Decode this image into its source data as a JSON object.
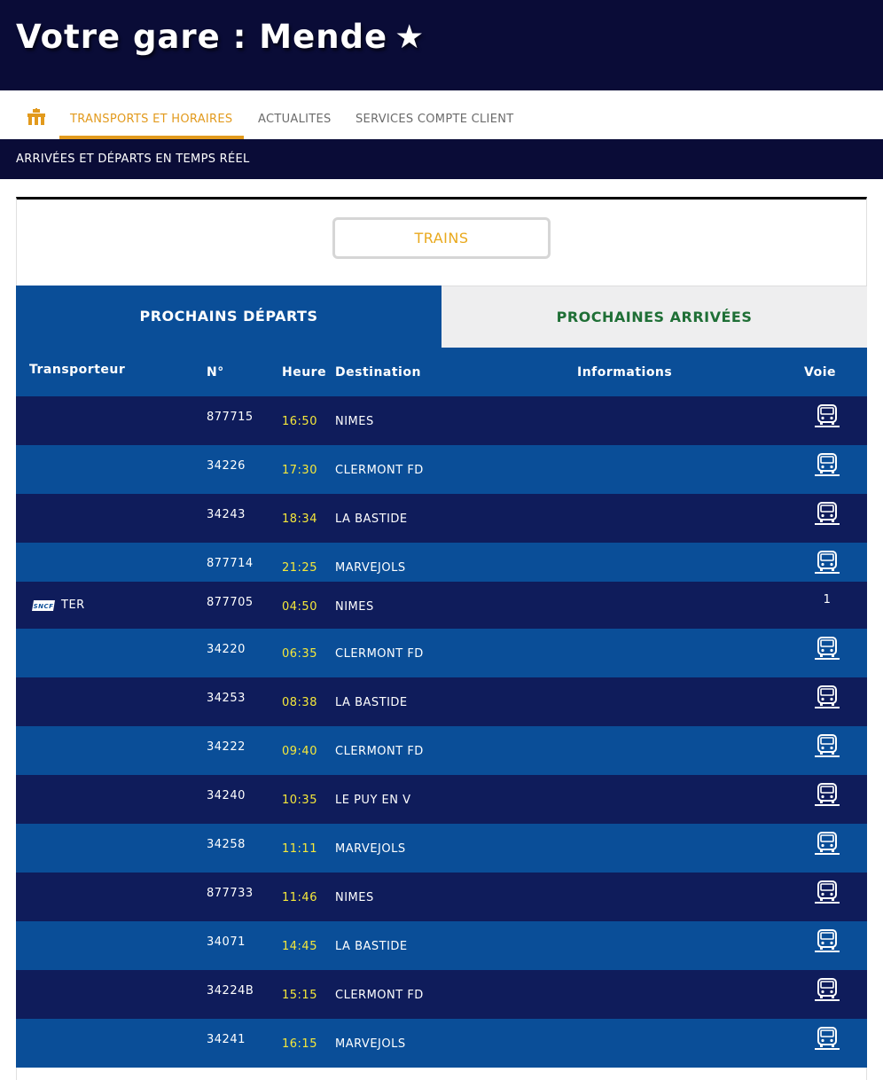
{
  "header": {
    "title": "Votre gare : Mende",
    "star": "★"
  },
  "nav": {
    "items": [
      {
        "label": "TRANSPORTS ET HORAIRES"
      },
      {
        "label": "ACTUALITES"
      },
      {
        "label": "SERVICES COMPTE CLIENT"
      }
    ]
  },
  "subbar": {
    "text": "ARRIVÉES ET DÉPARTS EN TEMPS RÉEL"
  },
  "filter": {
    "trains_label": "TRAINS"
  },
  "tabs": {
    "departures": "PROCHAINS DÉPARTS",
    "arrivals": "PROCHAINES ARRIVÉES"
  },
  "table": {
    "headers": {
      "transporteur": "Transporteur",
      "numero": "N°",
      "heure": "Heure",
      "destination": "Destination",
      "informations": "Informations",
      "voie": "Voie"
    },
    "rows": [
      {
        "carrier": "",
        "number": "877715",
        "time": "16:50",
        "destination": "NIMES",
        "voie": "bus-icon"
      },
      {
        "carrier": "",
        "number": "34226",
        "time": "17:30",
        "destination": "CLERMONT FD",
        "voie": "bus-icon"
      },
      {
        "carrier": "",
        "number": "34243",
        "time": "18:34",
        "destination": "LA BASTIDE",
        "voie": "bus-icon"
      },
      {
        "carrier": "",
        "number": "877714",
        "time": "21:25",
        "destination": "MARVEJOLS",
        "voie": "bus-icon"
      },
      {
        "carrier": "TER",
        "number": "877705",
        "time": "04:50",
        "destination": "NIMES",
        "voie": "1"
      },
      {
        "carrier": "",
        "number": "34220",
        "time": "06:35",
        "destination": "CLERMONT FD",
        "voie": "bus-icon"
      },
      {
        "carrier": "",
        "number": "34253",
        "time": "08:38",
        "destination": "LA BASTIDE",
        "voie": "bus-icon"
      },
      {
        "carrier": "",
        "number": "34222",
        "time": "09:40",
        "destination": "CLERMONT FD",
        "voie": "bus-icon"
      },
      {
        "carrier": "",
        "number": "34240",
        "time": "10:35",
        "destination": "LE PUY EN V",
        "voie": "bus-icon"
      },
      {
        "carrier": "",
        "number": "34258",
        "time": "11:11",
        "destination": "MARVEJOLS",
        "voie": "bus-icon"
      },
      {
        "carrier": "",
        "number": "877733",
        "time": "11:46",
        "destination": "NIMES",
        "voie": "bus-icon"
      },
      {
        "carrier": "",
        "number": "34071",
        "time": "14:45",
        "destination": "LA BASTIDE",
        "voie": "bus-icon"
      },
      {
        "carrier": "",
        "number": "34224B",
        "time": "15:15",
        "destination": "CLERMONT FD",
        "voie": "bus-icon"
      },
      {
        "carrier": "",
        "number": "34241",
        "time": "16:15",
        "destination": "MARVEJOLS",
        "voie": "bus-icon"
      }
    ]
  },
  "colors": {
    "header_bg": "#0a0c37",
    "accent_orange": "#e29a1d",
    "row_dark": "#0f1c5b",
    "row_light": "#0a4e98",
    "time_yellow": "#f5e83a",
    "arrivals_green": "#1f6f36"
  }
}
